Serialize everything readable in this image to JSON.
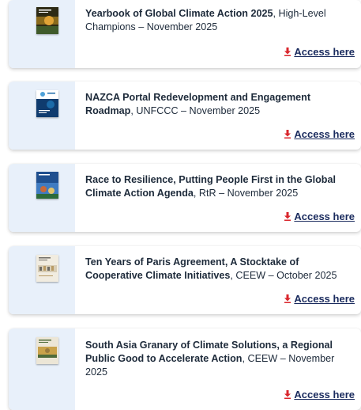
{
  "items": [
    {
      "title_bold": "Yearbook of Global Climate Action 2025",
      "title_rest": ", High-Level Champions – November 2025",
      "cover_colors": [
        "#2d2a14",
        "#8a6a1c",
        "#e0a336",
        "#3f5a2a"
      ],
      "access_label": "Access here"
    },
    {
      "title_bold": "NAZCA Portal Redevelopment and Engagement Roadmap",
      "title_rest": ", UNFCCC – November 2025",
      "cover_colors": [
        "#0f3b6e",
        "#1b6aa8",
        "#4fa1d8",
        "#ffffff"
      ],
      "access_label": "Access here"
    },
    {
      "title_bold": "Race to Resilience, Putting People First in the Global Climate Action Agenda",
      "title_rest": ", RtR – November 2025",
      "cover_colors": [
        "#1f4f8f",
        "#3f7bc1",
        "#c7683a",
        "#e2c36a"
      ],
      "access_label": "Access here"
    },
    {
      "title_bold": "Ten Years of Paris Agreement, A Stocktake of Cooperative Climate Initiatives",
      "title_rest": ", CEEW – October 2025",
      "cover_colors": [
        "#f1ece0",
        "#d8cdb5",
        "#6d6a63",
        "#b89a64"
      ],
      "access_label": "Access here"
    },
    {
      "title_bold": "South Asia Granary of Climate Solutions, a Regional Public Good to Accelerate Action",
      "title_rest": ", CEEW – November 2025",
      "cover_colors": [
        "#ece6d6",
        "#c9a24a",
        "#4f6b3a",
        "#9a7a3c"
      ],
      "access_label": "Access here"
    }
  ],
  "colors": {
    "link": "#1a2b5e",
    "download_icon": "#d9262c",
    "thumb_bg": "#e8f0fa"
  }
}
